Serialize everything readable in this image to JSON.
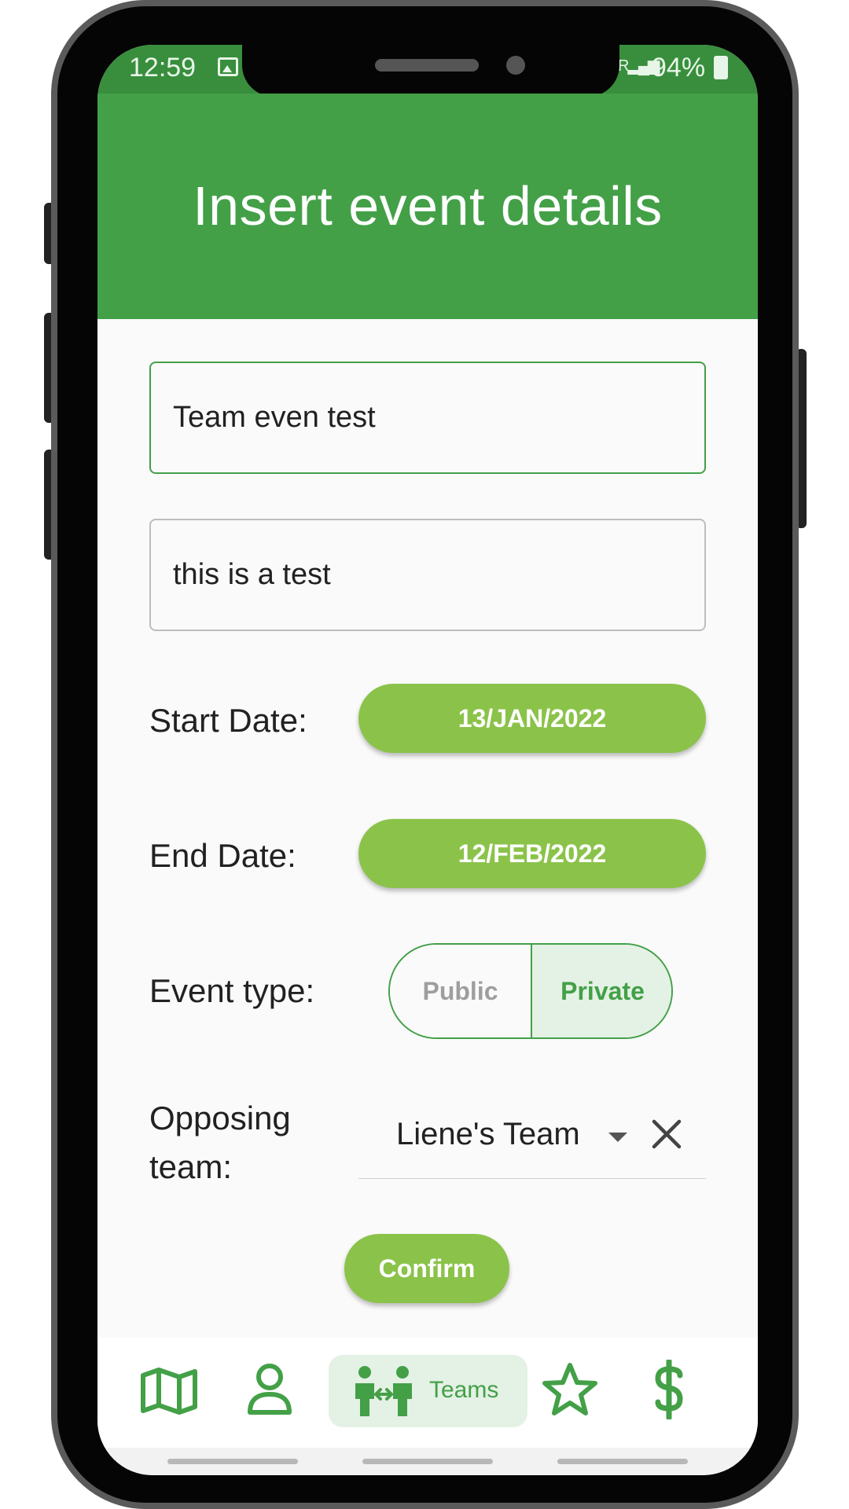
{
  "status_bar": {
    "time": "12:59",
    "signal": "R",
    "battery": "94%"
  },
  "header": {
    "title": "Insert event details"
  },
  "form": {
    "event_name": "Team even test",
    "event_description": "this is a test",
    "start_date_label": "Start Date:",
    "start_date_value": "13/JAN/2022",
    "end_date_label": "End Date:",
    "end_date_value": "12/FEB/2022",
    "event_type_label": "Event type:",
    "event_type_options": [
      "Public",
      "Private"
    ],
    "event_type_selected": "Private",
    "opposing_team_label_line1": "Opposing",
    "opposing_team_label_line2": "team:",
    "opposing_team_value": "Liene's Team",
    "confirm_label": "Confirm"
  },
  "nav": {
    "items": [
      {
        "icon": "map-icon"
      },
      {
        "icon": "person-icon"
      },
      {
        "icon": "teams-icon",
        "label": "Teams",
        "active": true
      },
      {
        "icon": "star-icon"
      },
      {
        "icon": "dollar-icon"
      }
    ]
  },
  "colors": {
    "status_bar": "#388e3c",
    "header": "#43a047",
    "accent_button": "#8bc34a",
    "active_bg": "#e4f1e5"
  }
}
